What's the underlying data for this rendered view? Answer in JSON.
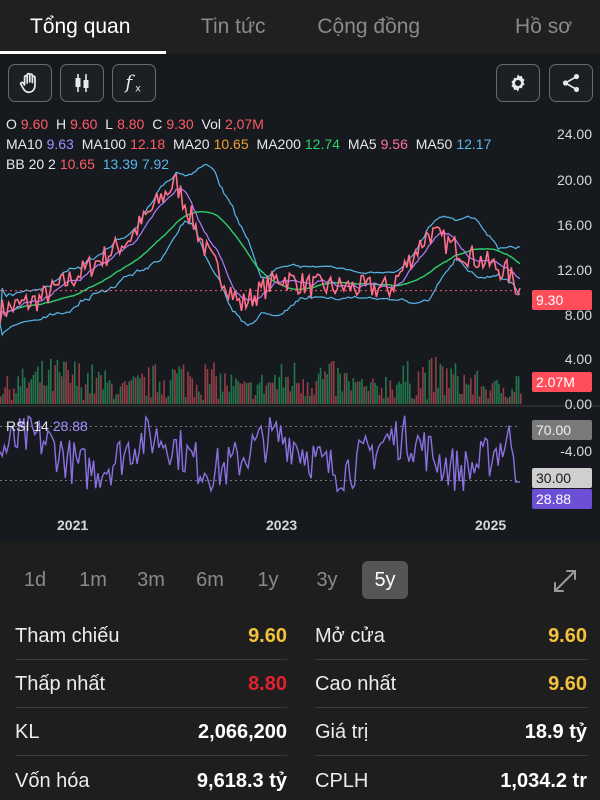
{
  "tabs": [
    "Tổng quan",
    "Tin tức",
    "Cộng đồng",
    "Hồ sơ"
  ],
  "ohlc": {
    "o_label": "O",
    "o": "9.60",
    "h_label": "H",
    "h": "9.60",
    "l_label": "L",
    "l": "8.80",
    "c_label": "C",
    "c": "9.30",
    "vol_label": "Vol",
    "vol": "2,07M"
  },
  "ma_line": {
    "ma10_label": "MA10",
    "ma10": "9.63",
    "ma100_label": "MA100",
    "ma100": "12.18",
    "ma20_label": "MA20",
    "ma20": "10.65",
    "ma200_label": "MA200",
    "ma200": "12.74",
    "ma5_label": "MA5",
    "ma5": "9.56",
    "ma50_label": "MA50",
    "ma50": "12.17"
  },
  "bb_line": {
    "label": "BB 20 2",
    "v1": "10.65",
    "v2": "13.39",
    "v3": "7.92"
  },
  "rsi": {
    "label": "RSI 14",
    "value": "28.88"
  },
  "price_axis": [
    "24.00",
    "20.00",
    "16.00",
    "12.00",
    "8.00",
    "4.00",
    "0.00"
  ],
  "price_badge": "9.30",
  "volume_badge": "2.07M",
  "rsi_axis": {
    "upper": "70.00",
    "mid": "-4.00",
    "lower": "30.00",
    "current": "28.88"
  },
  "years": [
    "2021",
    "2023",
    "2025"
  ],
  "periods": [
    "1d",
    "1m",
    "3m",
    "6m",
    "1y",
    "3y",
    "5y"
  ],
  "active_period": "5y",
  "stats": {
    "tham_chieu": {
      "label": "Tham chiếu",
      "value": "9.60"
    },
    "mo_cua": {
      "label": "Mở cửa",
      "value": "9.60"
    },
    "thap_nhat": {
      "label": "Thấp nhất",
      "value": "8.80"
    },
    "cao_nhat": {
      "label": "Cao nhất",
      "value": "9.60"
    },
    "kl": {
      "label": "KL",
      "value": "2,066,200"
    },
    "gia_tri": {
      "label": "Giá trị",
      "value": "18.9 tỷ"
    },
    "von_hoa": {
      "label": "Vốn hóa",
      "value": "9,618.3 tỷ"
    },
    "cplh": {
      "label": "CPLH",
      "value": "1,034.2 tr"
    }
  },
  "colors": {
    "up": "#2fbf71",
    "down": "#ff5a66",
    "ma20": "#2fcf6a",
    "bb": "#58b6e8",
    "rsi": "#8a70e0",
    "highlight": "#f3c23a",
    "low": "#e0222f"
  }
}
